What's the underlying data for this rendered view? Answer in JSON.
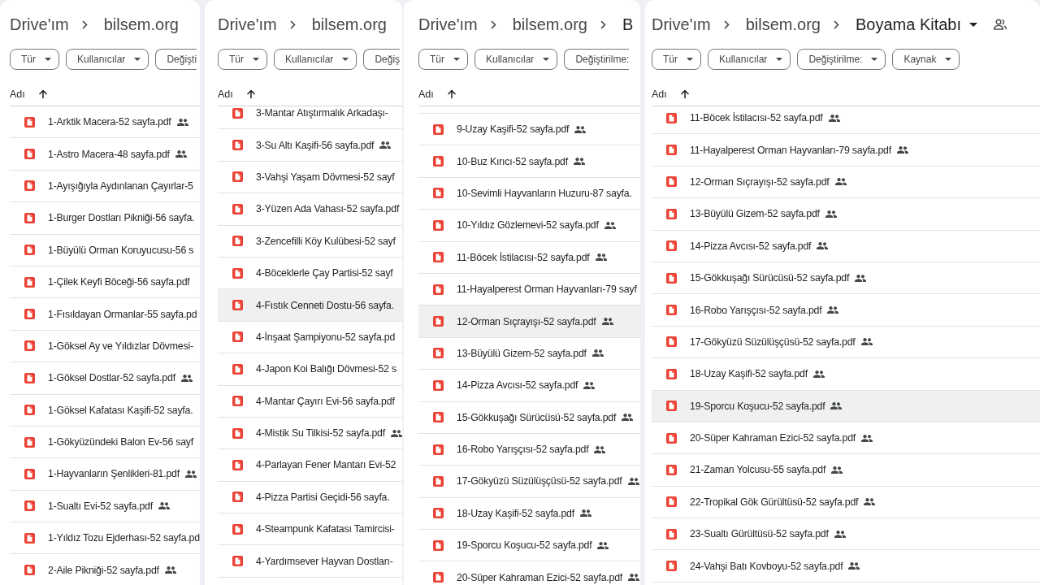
{
  "panels": [
    {
      "breadcrumb": [
        {
          "label": "Drive'ım",
          "current": false,
          "menu": false,
          "shared": false
        },
        {
          "label": "bilsem.org",
          "current": false,
          "menu": false,
          "shared": false
        }
      ],
      "filters": [
        {
          "label": "Tür",
          "clipped": false
        },
        {
          "label": "Kullanıcılar",
          "clipped": false
        },
        {
          "label": "Değişti",
          "clipped": true
        }
      ],
      "column": {
        "label": "Adı",
        "ascending": true
      },
      "files": [
        {
          "name": "1-Arktik Macera-52 sayfa.pdf",
          "shared": true,
          "highlighted": false
        },
        {
          "name": "1-Astro Macera-48 sayfa.pdf",
          "shared": true,
          "highlighted": false
        },
        {
          "name": "1-Ayışığıyla Aydınlanan Çayırlar-5",
          "shared": false,
          "highlighted": false
        },
        {
          "name": "1-Burger Dostları Pikniği-56 sayfa.",
          "shared": false,
          "highlighted": false
        },
        {
          "name": "1-Büyülü Orman Koruyucusu-56 s",
          "shared": false,
          "highlighted": false
        },
        {
          "name": "1-Çilek Keyfi Böceği-56 sayfa.pdf",
          "shared": false,
          "highlighted": false
        },
        {
          "name": "1-Fısıldayan Ormanlar-55 sayfa.pd",
          "shared": false,
          "highlighted": false
        },
        {
          "name": "1-Göksel Ay ve Yıldızlar Dövmesi-",
          "shared": false,
          "highlighted": false
        },
        {
          "name": "1-Göksel Dostlar-52 sayfa.pdf",
          "shared": true,
          "highlighted": false
        },
        {
          "name": "1-Göksel Kafatası Kaşifi-52 sayfa.",
          "shared": false,
          "highlighted": false
        },
        {
          "name": "1-Gökyüzündeki Balon Ev-56 sayf",
          "shared": false,
          "highlighted": false
        },
        {
          "name": "1-Hayvanların Şenlikleri-81.pdf",
          "shared": true,
          "highlighted": false
        },
        {
          "name": "1-Sualtı Evi-52 sayfa.pdf",
          "shared": true,
          "highlighted": false
        },
        {
          "name": "1-Yıldız Tozu Ejderhası-52 sayfa.pd",
          "shared": false,
          "highlighted": false
        },
        {
          "name": "2-Aile Pikniği-52 sayfa.pdf",
          "shared": true,
          "highlighted": false
        }
      ]
    },
    {
      "breadcrumb": [
        {
          "label": "Drive'ım",
          "current": false,
          "menu": false,
          "shared": false
        },
        {
          "label": "bilsem.org",
          "current": false,
          "menu": false,
          "shared": false
        }
      ],
      "filters": [
        {
          "label": "Tür",
          "clipped": false
        },
        {
          "label": "Kullanıcılar",
          "clipped": false
        },
        {
          "label": "Değiş",
          "clipped": true
        }
      ],
      "column": {
        "label": "Adı",
        "ascending": true
      },
      "files": [
        {
          "name": "3-Mantar Atıştırmalık Arkadaşı-",
          "shared": false,
          "highlighted": false
        },
        {
          "name": "3-Su Altı Kaşifi-56 sayfa.pdf",
          "shared": true,
          "highlighted": false
        },
        {
          "name": "3-Vahşi Yaşam Dövmesi-52 sayf",
          "shared": false,
          "highlighted": false
        },
        {
          "name": "3-Yüzen Ada Vahası-52 sayfa.pdf",
          "shared": false,
          "highlighted": false
        },
        {
          "name": "3-Zencefilli Köy Kulübesi-52 sayf",
          "shared": false,
          "highlighted": false
        },
        {
          "name": "4-Böceklerle Çay Partisi-52 sayf",
          "shared": false,
          "highlighted": false
        },
        {
          "name": "4-Fıstık Cenneti Dostu-56 sayfa.",
          "shared": false,
          "highlighted": true
        },
        {
          "name": "4-İnşaat Şampiyonu-52 sayfa.pd",
          "shared": false,
          "highlighted": false
        },
        {
          "name": "4-Japon Koi Balığı Dövmesi-52 s",
          "shared": false,
          "highlighted": false
        },
        {
          "name": "4-Mantar Çayırı Evi-56 sayfa.pdf",
          "shared": false,
          "highlighted": false
        },
        {
          "name": "4-Mistik Su Tilkisi-52 sayfa.pdf",
          "shared": true,
          "highlighted": false
        },
        {
          "name": "4-Parlayan Fener Mantarı Evi-52",
          "shared": false,
          "highlighted": false
        },
        {
          "name": "4-Pizza Partisi Geçidi-56 sayfa.",
          "shared": false,
          "highlighted": false
        },
        {
          "name": "4-Steampunk Kafatası Tamircisi-",
          "shared": false,
          "highlighted": false
        },
        {
          "name": "4-Yardımsever Hayvan Dostları-",
          "shared": false,
          "highlighted": false
        }
      ]
    },
    {
      "breadcrumb": [
        {
          "label": "Drive'ım",
          "current": false,
          "menu": false,
          "shared": false
        },
        {
          "label": "bilsem.org",
          "current": false,
          "menu": false,
          "shared": false
        },
        {
          "label": "B",
          "current": true,
          "menu": false,
          "shared": false
        }
      ],
      "filters": [
        {
          "label": "Tür",
          "clipped": false
        },
        {
          "label": "Kullanıcılar",
          "clipped": false
        },
        {
          "label": "Değiştirilme:",
          "clipped": true
        }
      ],
      "column": {
        "label": "Adı",
        "ascending": true
      },
      "files": [
        {
          "name": "9-Uzay Kaşifi-52 sayfa.pdf",
          "shared": true,
          "highlighted": false
        },
        {
          "name": "10-Buz Kırıcı-52 sayfa.pdf",
          "shared": true,
          "highlighted": false
        },
        {
          "name": "10-Sevimli Hayvanların Huzuru-87 sayfa.",
          "shared": false,
          "highlighted": false
        },
        {
          "name": "10-Yıldız Gözlemevi-52 sayfa.pdf",
          "shared": true,
          "highlighted": false
        },
        {
          "name": "11-Böcek İstilacısı-52 sayfa.pdf",
          "shared": true,
          "highlighted": false
        },
        {
          "name": "11-Hayalperest Orman Hayvanları-79 sayf",
          "shared": false,
          "highlighted": false
        },
        {
          "name": "12-Orman Sıçrayışı-52 sayfa.pdf",
          "shared": true,
          "highlighted": true
        },
        {
          "name": "13-Büyülü Gizem-52 sayfa.pdf",
          "shared": true,
          "highlighted": false
        },
        {
          "name": "14-Pizza Avcısı-52 sayfa.pdf",
          "shared": true,
          "highlighted": false
        },
        {
          "name": "15-Gökkuşağı Sürücüsü-52 sayfa.pdf",
          "shared": true,
          "highlighted": false
        },
        {
          "name": "16-Robo Yarışçısı-52 sayfa.pdf",
          "shared": true,
          "highlighted": false
        },
        {
          "name": "17-Gökyüzü Süzülüşçüsü-52 sayfa.pdf",
          "shared": true,
          "highlighted": false
        },
        {
          "name": "18-Uzay Kaşifi-52 sayfa.pdf",
          "shared": true,
          "highlighted": false
        },
        {
          "name": "19-Sporcu Koşucu-52 sayfa.pdf",
          "shared": true,
          "highlighted": false
        },
        {
          "name": "20-Süper Kahraman Ezici-52 sayfa.pdf",
          "shared": true,
          "highlighted": false
        }
      ]
    },
    {
      "breadcrumb": [
        {
          "label": "Drive'ım",
          "current": false,
          "menu": false,
          "shared": false
        },
        {
          "label": "bilsem.org",
          "current": false,
          "menu": false,
          "shared": false
        },
        {
          "label": "Boyama Kitabı",
          "current": true,
          "menu": true,
          "shared": true
        }
      ],
      "filters": [
        {
          "label": "Tür",
          "clipped": false
        },
        {
          "label": "Kullanıcılar",
          "clipped": false
        },
        {
          "label": "Değiştirilme:",
          "clipped": false
        },
        {
          "label": "Kaynak",
          "clipped": false
        }
      ],
      "column": {
        "label": "Adı",
        "ascending": true
      },
      "files": [
        {
          "name": "11-Böcek İstilacısı-52 sayfa.pdf",
          "shared": true,
          "highlighted": false
        },
        {
          "name": "11-Hayalperest Orman Hayvanları-79 sayfa.pdf",
          "shared": true,
          "highlighted": false
        },
        {
          "name": "12-Orman Sıçrayışı-52 sayfa.pdf",
          "shared": true,
          "highlighted": false
        },
        {
          "name": "13-Büyülü Gizem-52 sayfa.pdf",
          "shared": true,
          "highlighted": false
        },
        {
          "name": "14-Pizza Avcısı-52 sayfa.pdf",
          "shared": true,
          "highlighted": false
        },
        {
          "name": "15-Gökkuşağı Sürücüsü-52 sayfa.pdf",
          "shared": true,
          "highlighted": false
        },
        {
          "name": "16-Robo Yarışçısı-52 sayfa.pdf",
          "shared": true,
          "highlighted": false
        },
        {
          "name": "17-Gökyüzü Süzülüşçüsü-52 sayfa.pdf",
          "shared": true,
          "highlighted": false
        },
        {
          "name": "18-Uzay Kaşifi-52 sayfa.pdf",
          "shared": true,
          "highlighted": false
        },
        {
          "name": "19-Sporcu Koşucu-52 sayfa.pdf",
          "shared": true,
          "highlighted": true
        },
        {
          "name": "20-Süper Kahraman Ezici-52 sayfa.pdf",
          "shared": true,
          "highlighted": false
        },
        {
          "name": "21-Zaman Yolcusu-55 sayfa.pdf",
          "shared": true,
          "highlighted": false
        },
        {
          "name": "22-Tropikal Gök Gürültüsü-52 sayfa.pdf",
          "shared": true,
          "highlighted": false
        },
        {
          "name": "23-Sualtı Gürültüsü-52 sayfa.pdf",
          "shared": true,
          "highlighted": false
        },
        {
          "name": "24-Vahşi Batı Kovboyu-52 sayfa.pdf",
          "shared": true,
          "highlighted": false
        }
      ]
    }
  ]
}
